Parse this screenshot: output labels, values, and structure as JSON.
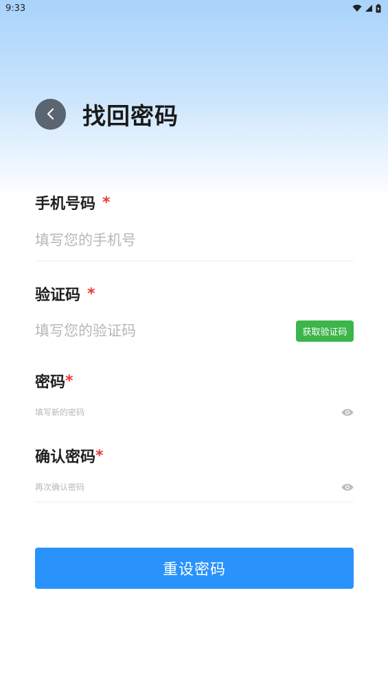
{
  "status_bar": {
    "time": "9:33"
  },
  "header": {
    "title": "找回密码"
  },
  "fields": {
    "phone": {
      "label": "手机号码",
      "required_mark": "*",
      "placeholder": "填写您的手机号",
      "value": ""
    },
    "code": {
      "label": "验证码",
      "required_mark": "*",
      "placeholder": "填写您的验证码",
      "value": "",
      "button_label": "获取验证码"
    },
    "password": {
      "label": "密码",
      "required_mark": "*",
      "placeholder": "填写新的密码",
      "value": ""
    },
    "confirm_password": {
      "label": "确认密码",
      "required_mark": "*",
      "placeholder": "再次确认密码",
      "value": ""
    }
  },
  "submit": {
    "label": "重设密码"
  },
  "colors": {
    "primary": "#2a93fb",
    "code_button": "#3cb54a",
    "required": "#e53935",
    "back_button": "#5b6471"
  },
  "icons": {
    "back": "chevron-left-icon",
    "eye": "eye-icon",
    "wifi": "wifi-icon",
    "signal": "signal-icon",
    "battery": "battery-icon"
  }
}
